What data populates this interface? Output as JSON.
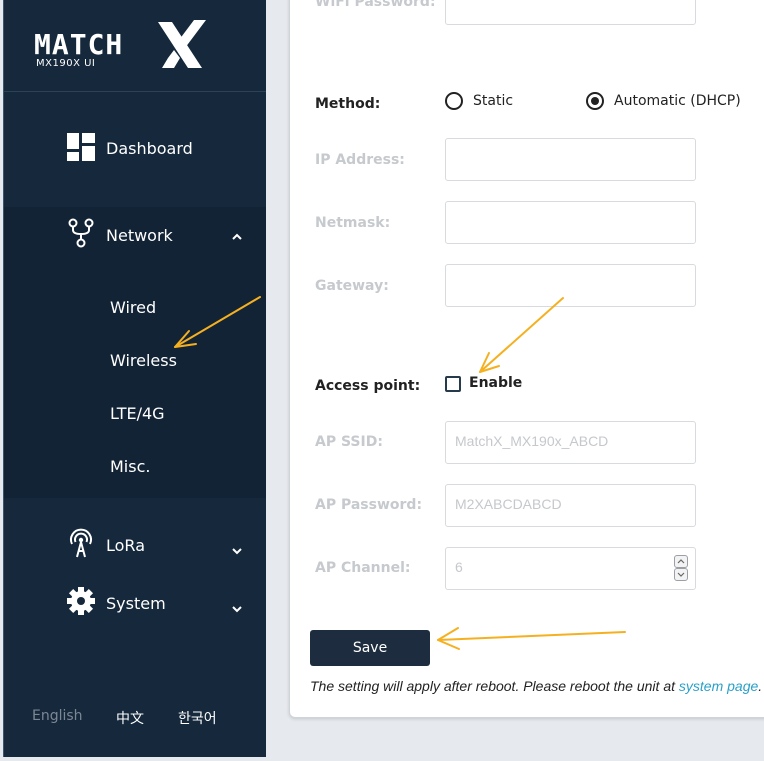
{
  "brand": {
    "logo_text": "MATCH",
    "subtitle": "MX190X UI"
  },
  "sidebar": {
    "dashboard": "Dashboard",
    "network": "Network",
    "network_sub": [
      "Wired",
      "Wireless",
      "LTE/4G",
      "Misc."
    ],
    "lora": "LoRa",
    "system": "System",
    "languages": [
      "English",
      "中文",
      "한국어"
    ]
  },
  "form": {
    "wifi_password_label": "WiFi Password:",
    "method_label": "Method:",
    "method_options": [
      "Static",
      "Automatic (DHCP)"
    ],
    "method_selected": "Automatic (DHCP)",
    "ip_label": "IP Address:",
    "netmask_label": "Netmask:",
    "gateway_label": "Gateway:",
    "ap_label": "Access point:",
    "ap_enable_label": "Enable",
    "ap_enabled": false,
    "ap_ssid_label": "AP SSID:",
    "ap_ssid_placeholder": "MatchX_MX190x_ABCD",
    "ap_password_label": "AP Password:",
    "ap_password_placeholder": "M2XABCDABCD",
    "ap_channel_label": "AP Channel:",
    "ap_channel_placeholder": "6",
    "save_label": "Save",
    "note_prefix": "The setting will apply after reboot. Please reboot the unit at ",
    "note_link": "system page",
    "note_suffix": "."
  },
  "colors": {
    "sidebar_bg": "#15283c",
    "accent_link": "#2aa0c8",
    "annotation_arrow": "#f5b020"
  }
}
